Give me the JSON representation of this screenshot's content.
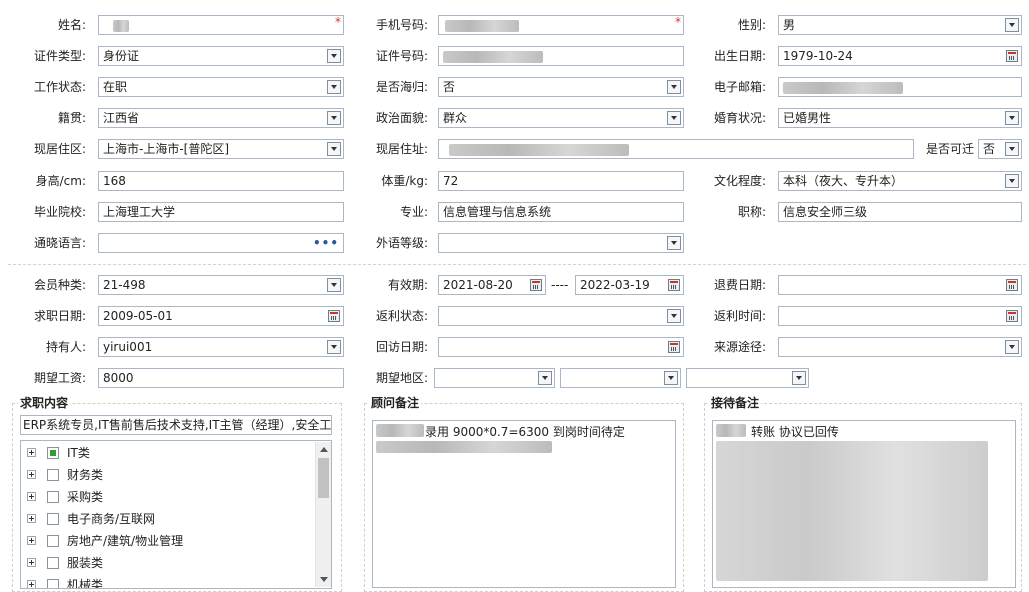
{
  "form": {
    "name_label": "姓名:",
    "name_required": "*",
    "phone_label": "手机号码:",
    "phone_required": "*",
    "gender_label": "性别:",
    "gender_value": "男",
    "id_type_label": "证件类型:",
    "id_type_value": "身份证",
    "id_no_label": "证件号码:",
    "birthdate_label": "出生日期:",
    "birthdate_value": "1979-10-24",
    "work_status_label": "工作状态:",
    "work_status_value": "在职",
    "returnee_label": "是否海归:",
    "returnee_value": "否",
    "email_label": "电子邮箱:",
    "native_label": "籍贯:",
    "native_value": "江西省",
    "political_label": "政治面貌:",
    "political_value": "群众",
    "marital_label": "婚育状况:",
    "marital_value": "已婚男性",
    "district_label": "现居住区:",
    "district_value": "上海市-上海市-[普陀区]",
    "address_label": "现居住址:",
    "relocate_label": "是否可迁",
    "relocate_value": "否",
    "height_label": "身高/cm:",
    "height_value": "168",
    "weight_label": "体重/kg:",
    "weight_value": "72",
    "education_label": "文化程度:",
    "education_value": "本科（夜大、专升本）",
    "school_label": "毕业院校:",
    "school_value": "上海理工大学",
    "major_label": "专业:",
    "major_value": "信息管理与信息系统",
    "title_label": "职称:",
    "title_value": "信息安全师三级",
    "language_label": "通晓语言:",
    "language_btn": "•••",
    "foreign_label": "外语等级:"
  },
  "membership": {
    "type_label": "会员种类:",
    "type_value": "21-498",
    "valid_label": "有效期:",
    "valid_from": "2021-08-20",
    "valid_sep": "----",
    "valid_to": "2022-03-19",
    "refund_date_label": "退费日期:",
    "job_date_label": "求职日期:",
    "job_date_value": "2009-05-01",
    "rebate_status_label": "返利状态:",
    "rebate_time_label": "返利时间:",
    "holder_label": "持有人:",
    "holder_value": "yirui001",
    "visit_date_label": "回访日期:",
    "source_label": "来源途径:",
    "salary_label": "期望工资:",
    "salary_value": "8000",
    "region_label": "期望地区:"
  },
  "panels": {
    "job_title": "求职内容",
    "job_summary": "ERP系统专员,IT售前售后技术支持,IT主管（经理）,安全工",
    "categories": [
      {
        "label": "IT类",
        "partial": true
      },
      {
        "label": "财务类",
        "partial": false
      },
      {
        "label": "采购类",
        "partial": false
      },
      {
        "label": "电子商务/互联网",
        "partial": false
      },
      {
        "label": "房地产/建筑/物业管理",
        "partial": false
      },
      {
        "label": "服装类",
        "partial": false
      },
      {
        "label": "机械类",
        "partial": false
      }
    ],
    "advisor_title": "顾问备注",
    "advisor_note": "录用  9000*0.7=6300   到岗时间待定",
    "reception_title": "接待备注",
    "reception_note": "转账  协议已回传"
  }
}
